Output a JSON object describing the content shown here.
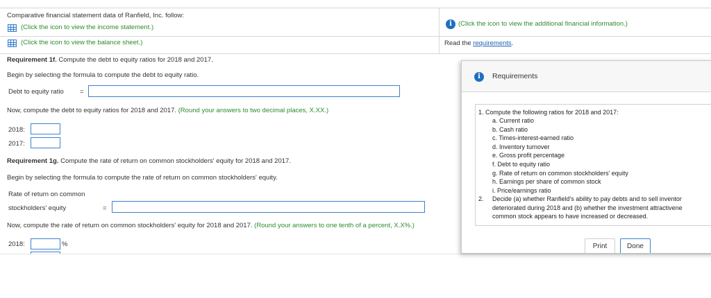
{
  "intro": {
    "text": "Comparative financial statement data of Ranfield, Inc. follow:",
    "income_link": "(Click the icon to view the income statement.)",
    "balance_link": "(Click the icon to view the balance sheet.)",
    "additional_link": "(Click the icon to view the additional financial information.)",
    "read_prefix": "Read the ",
    "requirements_link": "requirements",
    "read_suffix": "."
  },
  "req_1f": {
    "heading": "Requirement 1f.",
    "heading_text": " Compute the debt to equity ratios for 2018 and 2017.",
    "formula_prompt": "Begin by selecting the formula to compute the debt to equity ratio.",
    "formula_label": "Debt to equity ratio",
    "equals": "=",
    "compute_prompt": "Now, compute the debt to equity ratios for 2018 and 2017.",
    "compute_hint": "(Round your answers to two decimal places, X.XX.)",
    "year_2018": "2018:",
    "year_2017": "2017:"
  },
  "req_1g": {
    "heading": "Requirement 1g.",
    "heading_text": " Compute the rate of return on common stockholders' equity for 2018 and 2017.",
    "formula_prompt": "Begin by selecting the formula to compute the rate of return on common stockholders' equity.",
    "formula_label_line1": "Rate of return on common",
    "formula_label_line2": "stockholders' equity",
    "equals": "=",
    "compute_prompt": "Now, compute the rate of return on common stockholders' equity for 2018 and 2017.",
    "compute_hint": "(Round your answers to one tenth of a percent, X.X%.)",
    "year_2018": "2018:",
    "percent": "%"
  },
  "requirements_popup": {
    "title": "Requirements",
    "item1_num": "1.",
    "item1_text": "Compute the following ratios for 2018 and 2017:",
    "subitems": [
      "a.  Current ratio",
      "b.  Cash ratio",
      "c.  Times-interest-earned ratio",
      "d.  Inventory turnover",
      "e.  Gross profit percentage",
      "f.  Debt to equity ratio",
      "g.  Rate of return on common stockholders' equity",
      "h.  Earnings per share of common stock",
      "i.  Price/earnings ratio"
    ],
    "item2_num": "2.",
    "item2_line1": "Decide (a) whether Ranfield's ability to pay debts and to sell inventor",
    "item2_line2": "deteriorated during 2018 and (b) whether the investment attractivene",
    "item2_line3": "common stock appears to have increased or decreased.",
    "print_button": "Print",
    "done_button": "Done"
  },
  "colors": {
    "link_green": "#2e8b2e",
    "input_border": "#3d7fd1",
    "info_blue": "#1f6fc0"
  }
}
